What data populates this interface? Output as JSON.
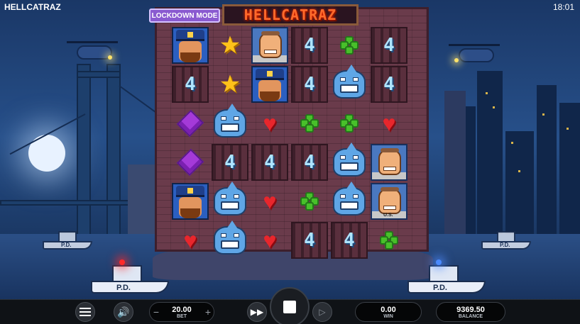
{
  "status_bar": {
    "title": "HELLCATRAZ",
    "time": "18:01"
  },
  "game": {
    "logo": "HELLCATRAZ",
    "mode_badge": "LOCKDOWN MODE",
    "boat_label": "P.D.",
    "prisoner_shirt": "U.S."
  },
  "reels": [
    [
      "guard",
      "bars",
      "gem",
      "gem",
      "guard",
      "heart"
    ],
    [
      "star",
      "star",
      "shark",
      "bars",
      "shark",
      "shark"
    ],
    [
      "prisoner",
      "guard",
      "heart",
      "bars",
      "heart",
      "heart"
    ],
    [
      "bars",
      "bars",
      "clover",
      "bars",
      "clover",
      "bars"
    ],
    [
      "clover",
      "shark",
      "clover",
      "shark",
      "shark",
      "bars"
    ],
    [
      "bars",
      "bars",
      "heart",
      "prisoner",
      "prisoner",
      "clover"
    ]
  ],
  "bars_digit": "4",
  "controls": {
    "bet_value": "20.00",
    "bet_label": "BET",
    "win_value": "0.00",
    "win_label": "WIN",
    "balance_value": "9369.50",
    "balance_label": "BALANCE",
    "minus": "−",
    "plus": "+"
  },
  "colors": {
    "logo": "#ff6a2b",
    "badge": "#8a5ad0",
    "accent_blue": "#5fa6e6"
  }
}
